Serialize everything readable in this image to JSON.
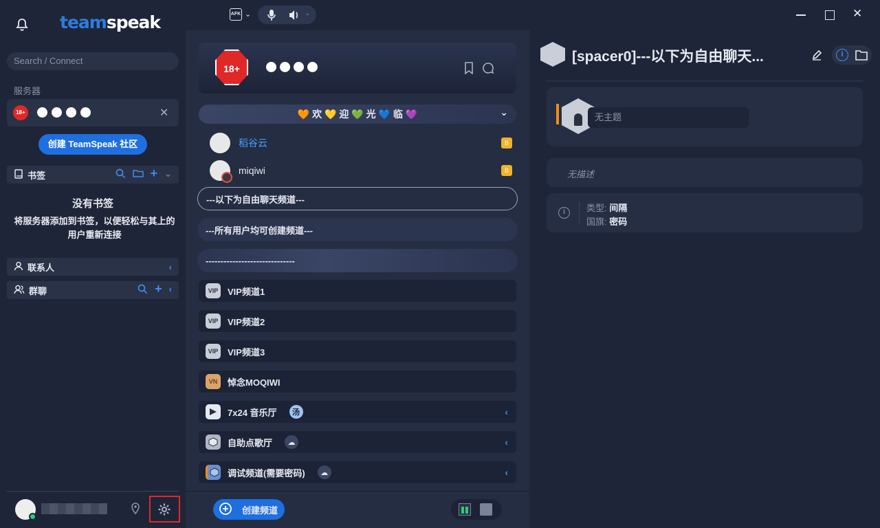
{
  "app": {
    "logo_part1": "team",
    "logo_part2": "speak"
  },
  "sidebar": {
    "search_placeholder": "Search / Connect",
    "servers_label": "服务器",
    "server_badge": "18+",
    "create_community_label": "创建 TeamSpeak 社区",
    "bookmarks_label": "书签",
    "no_bookmarks_title": "没有书签",
    "no_bookmarks_desc": "将服务器添加到书签，以便轻松与其上的用户重新连接",
    "contacts_label": "联系人",
    "group_chat_label": "群聊"
  },
  "topbar": {
    "afk_label": "AFK"
  },
  "center": {
    "banner_badge": "18+",
    "welcome_text": "🧡 欢 💛 迎 💚 光 💙 临 💜",
    "users": [
      {
        "name": "稻谷云",
        "color": "#4a9eff",
        "badge": "B"
      },
      {
        "name": "miqiwi",
        "color": "#e6e9f0",
        "badge": "B"
      }
    ],
    "spacers": [
      "---以下为自由聊天频道---",
      "---所有用户均可创建频道---",
      "------------------------------"
    ],
    "channels": [
      {
        "name": "VIP频道1",
        "icon": "VIP"
      },
      {
        "name": "VIP频道2",
        "icon": "VIP"
      },
      {
        "name": "VIP频道3",
        "icon": "VIP"
      },
      {
        "name": "悼念MOQIWI",
        "icon": "VN"
      },
      {
        "name": "7x24 音乐厅",
        "icon": "music",
        "badge": "汤",
        "expand": true
      },
      {
        "name": "自助点歌厅",
        "icon": "cube",
        "expand": true
      },
      {
        "name": "调试频道(需要密码)",
        "icon": "cube-blue",
        "expand": true
      }
    ],
    "create_channel_label": "创建频道"
  },
  "right": {
    "title": "[spacer0]---以下为自由聊天...",
    "no_subject": "无主题",
    "no_description": "无描述",
    "type_key": "类型:",
    "type_value": "间隔",
    "flag_key": "国旗:",
    "flag_value": "密码"
  },
  "colors": {
    "accent": "#1e6fe0",
    "link": "#3d8cf0",
    "highlight": "#e02828"
  }
}
